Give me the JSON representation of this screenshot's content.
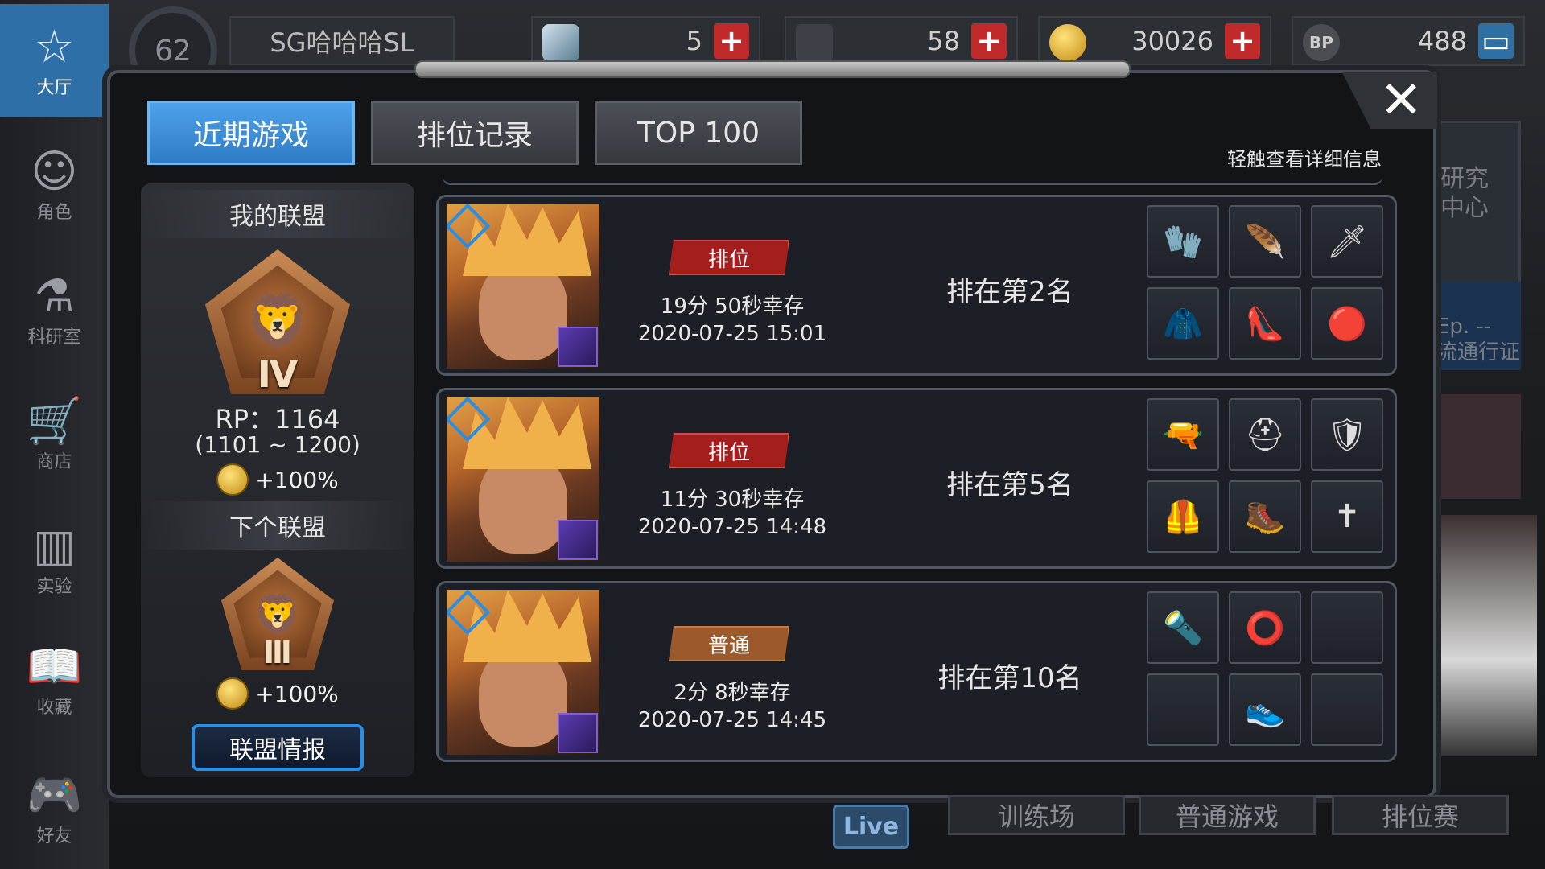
{
  "nav": {
    "items": [
      {
        "label": "大厅",
        "icon": "lobby-icon"
      },
      {
        "label": "角色",
        "icon": "character-icon"
      },
      {
        "label": "科研室",
        "icon": "lab-flask-icon"
      },
      {
        "label": "商店",
        "icon": "shop-cart-icon"
      },
      {
        "label": "实验",
        "icon": "books-icon"
      },
      {
        "label": "收藏",
        "icon": "book-open-icon"
      },
      {
        "label": "好友",
        "icon": "gamepad-icon"
      }
    ]
  },
  "top": {
    "level": "62",
    "player_name": "SG哈哈哈SL",
    "gems": "5",
    "tickets": "58",
    "coins": "30026",
    "bp": "488"
  },
  "modal": {
    "tabs": [
      "近期游戏",
      "排位记录",
      "TOP 100"
    ],
    "active_tab": 0,
    "hint": "轻触查看详细信息",
    "close_glyph": "✕"
  },
  "league": {
    "my_title": "我的联盟",
    "my_tier": "Ⅳ",
    "rp": "RP：1164",
    "rp_range": "(1101 ~ 1200)",
    "my_bonus": "+100%",
    "next_title": "下个联盟",
    "next_tier": "Ⅲ",
    "next_bonus": "+100%",
    "info_button": "联盟情报"
  },
  "games": [
    {
      "mode": "排位",
      "mode_type": "ranked",
      "survive": "19分 50秒幸存",
      "date": "2020-07-25 15:01",
      "place": "排在第2名",
      "items": [
        "🧤",
        "🪶",
        "🗡",
        "🧥",
        "👠",
        "🔴"
      ]
    },
    {
      "mode": "排位",
      "mode_type": "ranked",
      "survive": "11分 30秒幸存",
      "date": "2020-07-25 14:48",
      "place": "排在第5名",
      "items": [
        "🔫",
        "⛑",
        "🛡",
        "🦺",
        "🥾",
        "✝"
      ]
    },
    {
      "mode": "普通",
      "mode_type": "normal",
      "survive": "2分 8秒幸存",
      "date": "2020-07-25 14:45",
      "place": "排在第10名",
      "items": [
        "🔦",
        "⭕",
        "",
        "",
        "👟",
        ""
      ]
    }
  ],
  "bottom": {
    "live": "Live",
    "training": "训练场",
    "normal_game": "普通游戏",
    "ranked": "排位赛"
  },
  "bg_text": {
    "lab_center": "研究\n中心",
    "ep_pass": "Ep. --\n流通行证"
  },
  "colors": {
    "accent_blue": "#2f7cc6",
    "ranked_red": "#a51e1e",
    "normal_brown": "#9c5a2c",
    "plus_red": "#c02a2a"
  }
}
